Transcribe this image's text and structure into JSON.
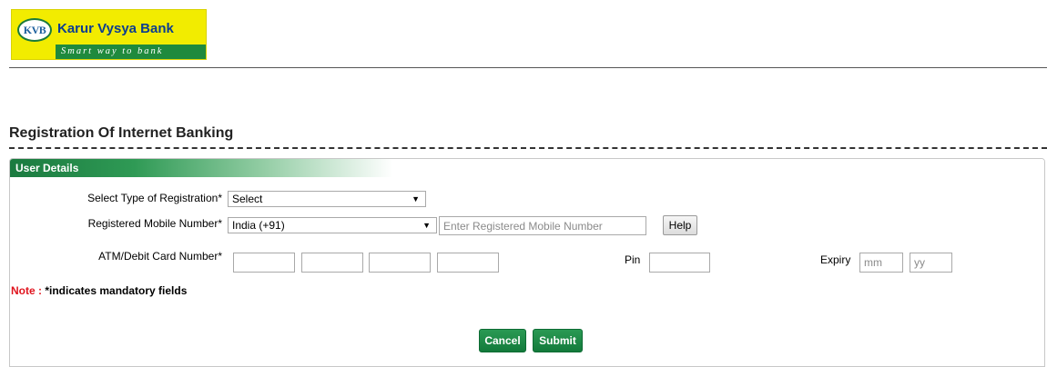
{
  "brand": {
    "logo_mark": "KVB",
    "name": "Karur Vysya Bank",
    "tagline": "Smart way to bank"
  },
  "page": {
    "title": "Registration Of Internet Banking"
  },
  "panel": {
    "heading": "User Details",
    "registration_type": {
      "label": "Select Type of Registration*",
      "value": "Select"
    },
    "mobile": {
      "label": "Registered Mobile Number*",
      "country_value": "India (+91)",
      "placeholder": "Enter Registered Mobile Number",
      "help_label": "Help"
    },
    "card": {
      "label": "ATM/Debit Card Number*",
      "segments": [
        "",
        "",
        "",
        ""
      ],
      "pin_label": "Pin",
      "expiry_label": "Expiry",
      "expiry_month_placeholder": "mm",
      "expiry_year_placeholder": "yy"
    },
    "note_key": "Note :",
    "note_text": " *indicates mandatory fields"
  },
  "actions": {
    "cancel_label": "Cancel",
    "submit_label": "Submit"
  },
  "colors": {
    "brand_yellow": "#f2ec00",
    "brand_green": "#1f8a3d",
    "button_green": "#137a3b",
    "note_red": "#e0141e"
  }
}
